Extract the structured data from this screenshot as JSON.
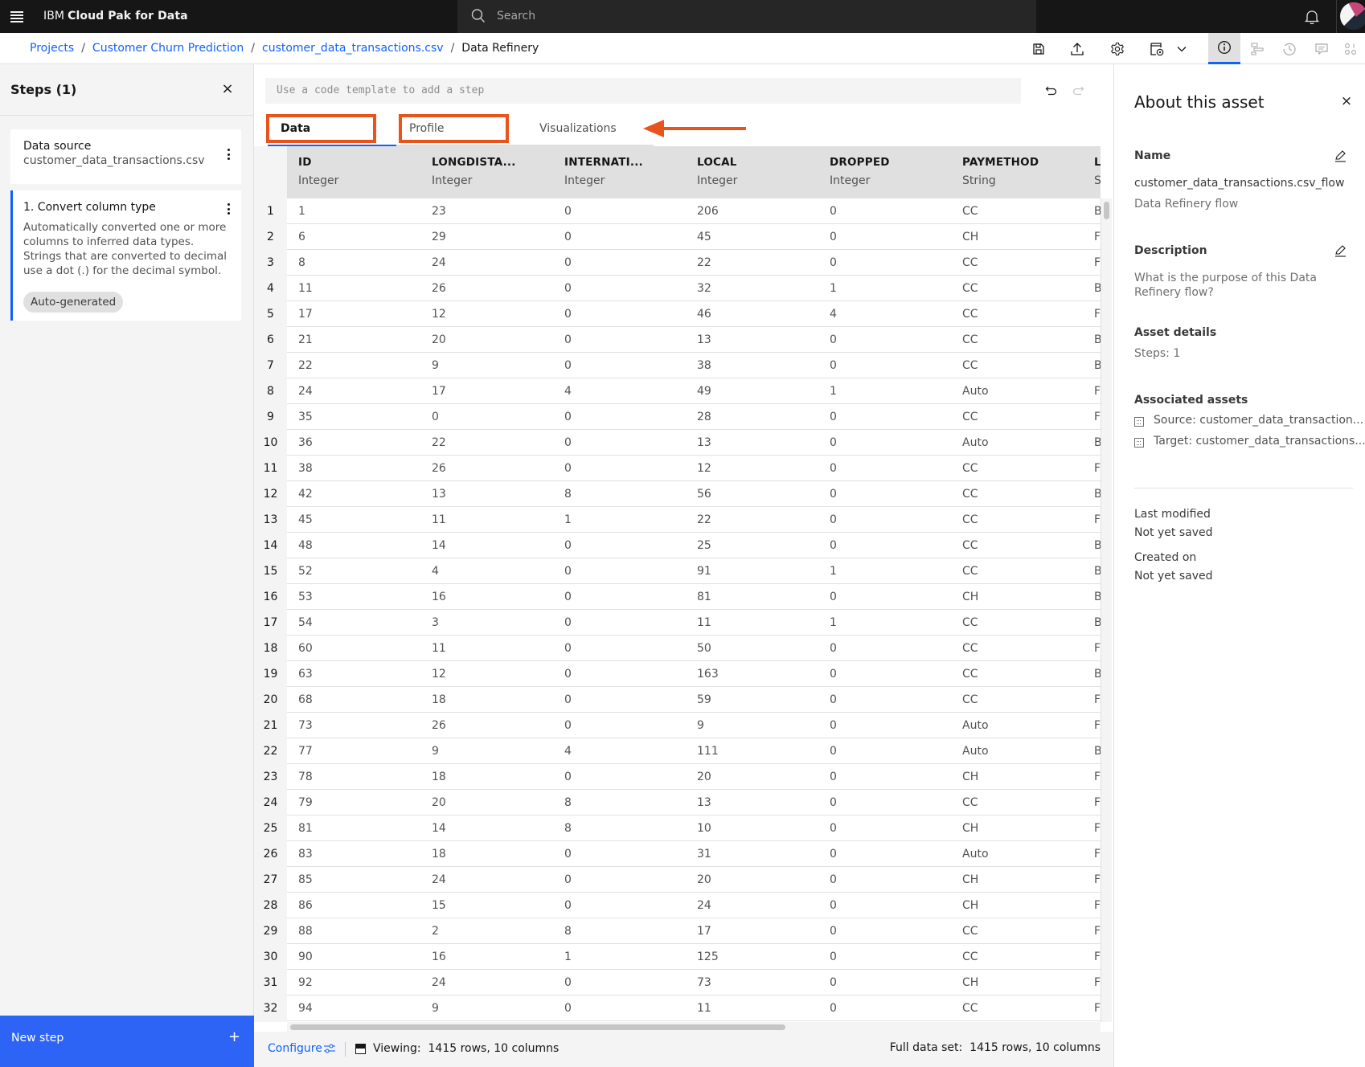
{
  "topbar": {
    "brand_prefix": "IBM",
    "brand_name": "Cloud Pak for Data",
    "search_placeholder": "Search"
  },
  "breadcrumb": {
    "items": [
      "Projects",
      "Customer Churn Prediction",
      "customer_data_transactions.csv"
    ],
    "separator": "/",
    "current": "Data Refinery"
  },
  "toolbar": {
    "icons": [
      "save-icon",
      "export-icon",
      "settings-icon",
      "schedule-job-icon",
      "chevron-down-icon",
      "info-icon",
      "lineage-icon",
      "history-icon",
      "comments-icon",
      "data-icon"
    ],
    "active": "info-icon"
  },
  "steps_panel": {
    "title": "Steps (1)",
    "source_card": {
      "label": "Data source",
      "value": "customer_data_transactions.csv"
    },
    "step_card": {
      "title": "1. Convert column type",
      "description": "Automatically converted one or more columns to inferred data types. Strings that are converted to decimal use a dot (.) for the decimal symbol.",
      "tag": "Auto-generated"
    },
    "new_step_label": "New step",
    "new_step_icon": "+"
  },
  "code_template": {
    "placeholder": "Use a code template to add a step"
  },
  "tabs": [
    {
      "label": "Data",
      "active": true
    },
    {
      "label": "Profile",
      "active": false
    },
    {
      "label": "Visualizations",
      "active": false
    }
  ],
  "annotation_color": "#e8541b",
  "accent_color": "#0f62fe",
  "table": {
    "columns": [
      {
        "name": "ID",
        "type": "Integer"
      },
      {
        "name": "LONGDISTA...",
        "type": "Integer"
      },
      {
        "name": "INTERNATI...",
        "type": "Integer"
      },
      {
        "name": "LOCAL",
        "type": "Integer"
      },
      {
        "name": "DROPPED",
        "type": "Integer"
      },
      {
        "name": "PAYMETHOD",
        "type": "String"
      },
      {
        "name": "L",
        "type": "S"
      }
    ],
    "rows": [
      [
        "1",
        "23",
        "0",
        "206",
        "0",
        "CC",
        "B"
      ],
      [
        "6",
        "29",
        "0",
        "45",
        "0",
        "CH",
        "F"
      ],
      [
        "8",
        "24",
        "0",
        "22",
        "0",
        "CC",
        "F"
      ],
      [
        "11",
        "26",
        "0",
        "32",
        "1",
        "CC",
        "B"
      ],
      [
        "17",
        "12",
        "0",
        "46",
        "4",
        "CC",
        "F"
      ],
      [
        "21",
        "20",
        "0",
        "13",
        "0",
        "CC",
        "B"
      ],
      [
        "22",
        "9",
        "0",
        "38",
        "0",
        "CC",
        "B"
      ],
      [
        "24",
        "17",
        "4",
        "49",
        "1",
        "Auto",
        "F"
      ],
      [
        "35",
        "0",
        "0",
        "28",
        "0",
        "CC",
        "F"
      ],
      [
        "36",
        "22",
        "0",
        "13",
        "0",
        "Auto",
        "B"
      ],
      [
        "38",
        "26",
        "0",
        "12",
        "0",
        "CC",
        "F"
      ],
      [
        "42",
        "13",
        "8",
        "56",
        "0",
        "CC",
        "B"
      ],
      [
        "45",
        "11",
        "1",
        "22",
        "0",
        "CC",
        "F"
      ],
      [
        "48",
        "14",
        "0",
        "25",
        "0",
        "CC",
        "B"
      ],
      [
        "52",
        "4",
        "0",
        "91",
        "1",
        "CC",
        "B"
      ],
      [
        "53",
        "16",
        "0",
        "81",
        "0",
        "CH",
        "B"
      ],
      [
        "54",
        "3",
        "0",
        "11",
        "1",
        "CC",
        "B"
      ],
      [
        "60",
        "11",
        "0",
        "50",
        "0",
        "CC",
        "F"
      ],
      [
        "63",
        "12",
        "0",
        "163",
        "0",
        "CC",
        "B"
      ],
      [
        "68",
        "18",
        "0",
        "59",
        "0",
        "CC",
        "F"
      ],
      [
        "73",
        "26",
        "0",
        "9",
        "0",
        "Auto",
        "F"
      ],
      [
        "77",
        "9",
        "4",
        "111",
        "0",
        "Auto",
        "B"
      ],
      [
        "78",
        "18",
        "0",
        "20",
        "0",
        "CH",
        "F"
      ],
      [
        "79",
        "20",
        "8",
        "13",
        "0",
        "CC",
        "F"
      ],
      [
        "81",
        "14",
        "8",
        "10",
        "0",
        "CH",
        "F"
      ],
      [
        "83",
        "18",
        "0",
        "31",
        "0",
        "Auto",
        "F"
      ],
      [
        "85",
        "24",
        "0",
        "20",
        "0",
        "CH",
        "F"
      ],
      [
        "86",
        "15",
        "0",
        "24",
        "0",
        "CH",
        "F"
      ],
      [
        "88",
        "2",
        "8",
        "17",
        "0",
        "CC",
        "F"
      ],
      [
        "90",
        "16",
        "1",
        "125",
        "0",
        "CC",
        "F"
      ],
      [
        "92",
        "24",
        "0",
        "73",
        "0",
        "CH",
        "F"
      ],
      [
        "94",
        "9",
        "0",
        "11",
        "0",
        "CC",
        "F"
      ]
    ]
  },
  "footer": {
    "configure_label": "Configure",
    "viewing_label": "Viewing:",
    "viewing_value": "1415 rows, 10 columns",
    "full_label": "Full data set:",
    "full_value": "1415 rows, 10 columns"
  },
  "about_panel": {
    "title": "About this asset",
    "name_heading": "Name",
    "name_value": "customer_data_transactions.csv_flow",
    "name_type": "Data Refinery flow",
    "description_heading": "Description",
    "description_placeholder": "What is the purpose of this Data Refinery flow?",
    "details_heading": "Asset details",
    "steps_value": "Steps: 1",
    "associated_heading": "Associated assets",
    "source_link": "Source: customer_data_transaction...",
    "target_link": "Target: customer_data_transactions...",
    "last_modified_label": "Last modified",
    "last_modified_value": "Not yet saved",
    "created_label": "Created on",
    "created_value": "Not yet saved"
  }
}
